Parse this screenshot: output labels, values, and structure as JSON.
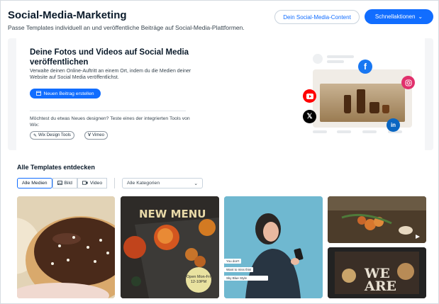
{
  "header": {
    "title": "Social-Media-Marketing",
    "subtitle": "Passe Templates individuell an und veröffentliche Beiträge auf Social-Media-Plattformen.",
    "secondary_button": "Dein Social-Media-Content",
    "primary_button": "Schnellaktionen"
  },
  "hero": {
    "title": "Deine Fotos und Videos auf Social Media veröffentlichen",
    "description": "Verwalte deinen Online-Auftritt an einem Ort, indem du die Medien deiner Website auf Social Media veröffentlichst.",
    "create_button": "Neuen Beitrag erstellen",
    "question": "Möchtest du etwas Neues designen? Teste eines der integrierten Tools von Wix:",
    "tools": [
      "Wix Design Tools",
      "Vimeo"
    ],
    "social_icons": [
      "facebook-icon",
      "instagram-icon",
      "youtube-icon",
      "x-icon",
      "linkedin-icon"
    ]
  },
  "templates": {
    "title": "Alle Templates entdecken",
    "filters": [
      {
        "label": "Alle Medien",
        "active": true
      },
      {
        "label": "Bild",
        "icon": "image-icon"
      },
      {
        "label": "Video",
        "icon": "video-icon"
      }
    ],
    "category_select": "Alle Kategorien",
    "tiles": {
      "menu_heading": "NEW MENU",
      "menu_badge": "Open Mon-Fri 12-10PM",
      "chat_1": "You don't",
      "chat_2": "Want to miss this!",
      "chat_3": "Sky Blue Style",
      "we_are": "WE ARE"
    }
  },
  "colors": {
    "accent": "#116dff",
    "facebook": "#1877f2",
    "instagram": "#e1306c",
    "youtube": "#ff0000",
    "x": "#000000",
    "linkedin": "#0a66c2"
  }
}
